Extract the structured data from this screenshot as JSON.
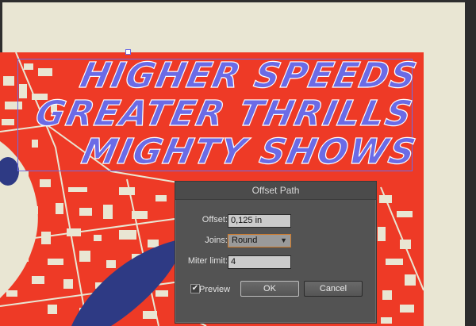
{
  "poster": {
    "line1": "HIGHER SPEEDS",
    "line2": "GREATER THRILLS",
    "line3": "MIGHTY SHOWS"
  },
  "dialog": {
    "title": "Offset Path",
    "offset_label": "Offset:",
    "offset_value": "0,125 in",
    "joins_label": "Joins:",
    "joins_value": "Round",
    "miter_label": "Miter limit:",
    "miter_value": "4",
    "preview_label": "Preview",
    "preview_checked": true,
    "ok_label": "OK",
    "cancel_label": "Cancel"
  },
  "colors": {
    "map_red": "#ee3a26",
    "paper": "#e9e6d3",
    "navy_shape": "#2e3a84",
    "text_fill": "#6b6be6"
  }
}
